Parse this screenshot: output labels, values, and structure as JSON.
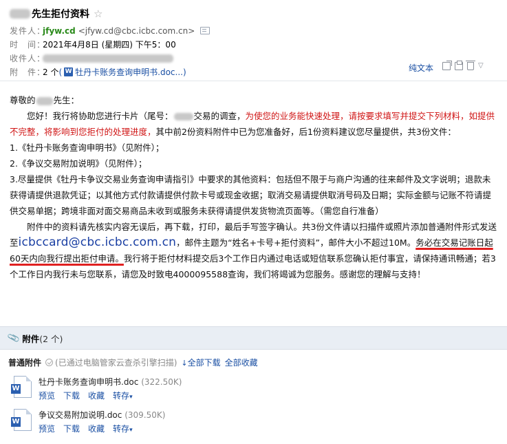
{
  "header": {
    "subject_suffix": "先生拒付资料",
    "sender_label": "发件人：",
    "sender_name": "jfyw.cd",
    "sender_email": "<jfyw.cd@cbc.icbc.com.cn>",
    "time_label": "时　间：",
    "time_value": "2021年4月8日 (星期四) 下午5：00",
    "recipient_label": "收件人：",
    "attachment_label": "附　件：",
    "attachment_count": "2 个",
    "attachment_open": "(",
    "attachment_preview": "牡丹卡账务查询申明书.doc...",
    "attachment_close": ")",
    "plain_text_link": "纯文本",
    "icons": [
      "newwindow-icon",
      "print-icon",
      "trash-icon",
      "fold-icon"
    ]
  },
  "body": {
    "greeting_prefix": "尊敬的",
    "greeting_suffix": "先生：",
    "para1_a": "您好！我行将协助您进行卡片（尾号：",
    "para1_b": "交易的调查，",
    "para1_red": "为使您的业务能快速处理，请按要求填写并提交下列材料，如提供不完整，将影响到您拒付的处理进度，",
    "para1_c": "其中前2份资料附件中已为您准备好，后1份资料建议您尽量提供，共3份文件：",
    "item1": "1.《牡丹卡账务查询申明书》（见附件）；",
    "item2": "2.《争议交易附加说明》（见附件）；",
    "item3": "3.尽量提供《牡丹卡争议交易业务查询申请指引》中要求的其他资料：包括但不限于与商户沟通的往来邮件及文字说明；退款未获得请提供退款凭证；以其他方式付款请提供付款卡号或现金收据；取消交易请提供取消号码及日期；实际金额与记账不符请提供交易单据；跨境非面对面交易商品未收到或服务未获得请提供发货物流页面等。（需您自行准备）",
    "para2_a": "附件中的资料请先核实内容无误后，再下载，打印，最后手写签字确认。共3份文件请以扫描件或照片添加普通附件形式发送至",
    "email": "icbccard@cbc.icbc.com.cn",
    "para2_b": "，邮件主题为“姓名+卡号+拒付资料”，邮件大小不超过10M。",
    "para2_ul": "务必在交易记账日起60天内向我行提出拒付申请。",
    "para2_c": "我行将于拒付材料提交后3个工作日内通过电话或短信联系您确认拒付事宜，请保持通讯畅通；若3个工作日内我行未与您联系，请您及时致电4000095588查询，我们将竭诚为您服务。感谢您的理解与支持！"
  },
  "attachments": {
    "title": "附件",
    "count": "(2 个)",
    "section_label": "普通附件",
    "scan_note": "(已通过电脑管家云查杀引擎扫描)",
    "download_all": "全部下载",
    "favorite_all": "全部收藏",
    "files": [
      {
        "name": "牡丹卡账务查询申明书.doc",
        "size": "(322.50K)",
        "actions": [
          "预览",
          "下载",
          "收藏",
          "转存"
        ]
      },
      {
        "name": "争议交易附加说明.doc",
        "size": "(309.50K)",
        "actions": [
          "预览",
          "下载",
          "收藏",
          "转存"
        ]
      }
    ]
  },
  "colors": {
    "link": "#1a4fa3",
    "red": "#d01515",
    "sender": "#2a8a1a",
    "bar": "#e9eef4"
  }
}
